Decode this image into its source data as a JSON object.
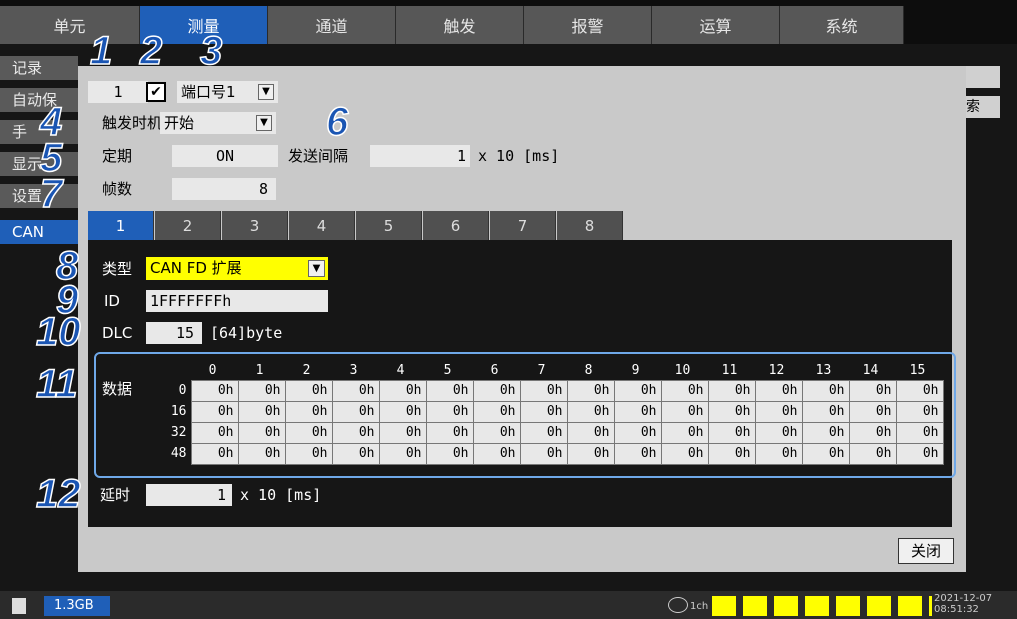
{
  "top_tabs": [
    "单元",
    "测量",
    "通道",
    "触发",
    "报警",
    "运算",
    "系统"
  ],
  "active_top_tab": "测量",
  "left_tabs": [
    "记录",
    "自动保",
    "手",
    "显示",
    "设置",
    "CAN"
  ],
  "right_bg_text": "索",
  "dialog": {
    "frame_no": "1",
    "port_value": "端口号1",
    "trigger_label": "触发时机",
    "trigger_value": "开始",
    "period_label": "定期",
    "period_value": "ON",
    "interval_label": "发送间隔",
    "interval_value": "1",
    "interval_unit": "x 10 [ms]",
    "frames_label": "帧数",
    "frames_value": "8",
    "frame_tabs": [
      "1",
      "2",
      "3",
      "4",
      "5",
      "6",
      "7",
      "8"
    ],
    "type_label": "类型",
    "type_value": "CAN FD 扩展",
    "id_label": "ID",
    "id_value": "1FFFFFFFh",
    "dlc_label": "DLC",
    "dlc_value": "15",
    "dlc_bytes": "[64]byte",
    "data_label": "数据",
    "data_cols": [
      "0",
      "1",
      "2",
      "3",
      "4",
      "5",
      "6",
      "7",
      "8",
      "9",
      "10",
      "11",
      "12",
      "13",
      "14",
      "15"
    ],
    "data_rows": [
      {
        "offset": "0",
        "cells": [
          "0h",
          "0h",
          "0h",
          "0h",
          "0h",
          "0h",
          "0h",
          "0h",
          "0h",
          "0h",
          "0h",
          "0h",
          "0h",
          "0h",
          "0h",
          "0h"
        ]
      },
      {
        "offset": "16",
        "cells": [
          "0h",
          "0h",
          "0h",
          "0h",
          "0h",
          "0h",
          "0h",
          "0h",
          "0h",
          "0h",
          "0h",
          "0h",
          "0h",
          "0h",
          "0h",
          "0h"
        ]
      },
      {
        "offset": "32",
        "cells": [
          "0h",
          "0h",
          "0h",
          "0h",
          "0h",
          "0h",
          "0h",
          "0h",
          "0h",
          "0h",
          "0h",
          "0h",
          "0h",
          "0h",
          "0h",
          "0h"
        ]
      },
      {
        "offset": "48",
        "cells": [
          "0h",
          "0h",
          "0h",
          "0h",
          "0h",
          "0h",
          "0h",
          "0h",
          "0h",
          "0h",
          "0h",
          "0h",
          "0h",
          "0h",
          "0h",
          "0h"
        ]
      }
    ],
    "delay_label": "延时",
    "delay_value": "1",
    "delay_unit": "x 10 [ms]",
    "close_label": "关闭"
  },
  "callouts": [
    "1",
    "2",
    "3",
    "4",
    "5",
    "6",
    "7",
    "8",
    "9",
    "10",
    "11",
    "12"
  ],
  "status": {
    "storage": "1.3GB",
    "date": "2021-12-07",
    "time": "08:51:32",
    "ch_label": "1ch"
  },
  "colors": {
    "accent": "#1f5fb8",
    "highlight": "#ffff00",
    "callout": "#1a55b3"
  }
}
